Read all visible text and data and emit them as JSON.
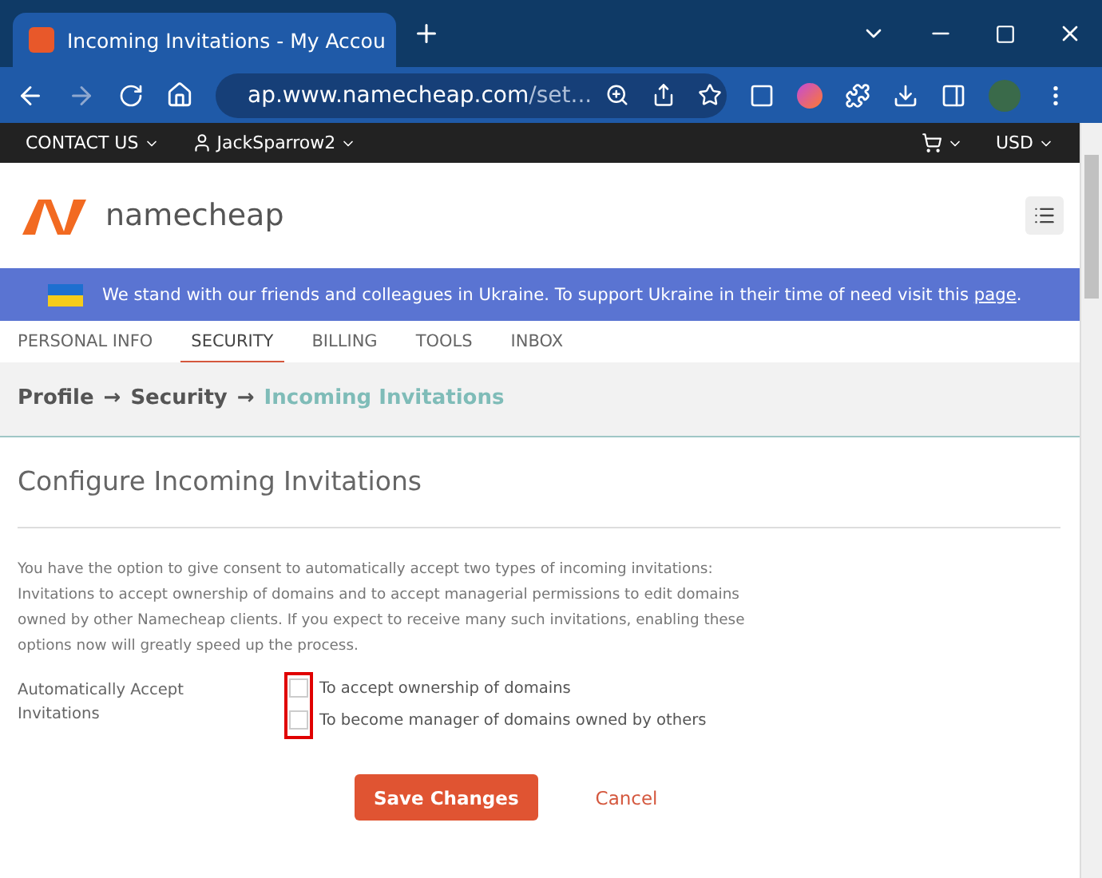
{
  "browser": {
    "tab_title": "Incoming Invitations - My Accou",
    "url_host": "ap.www.namecheap.com",
    "url_rest": "/set..."
  },
  "topbar": {
    "contact": "CONTACT US",
    "user": "JackSparrow2",
    "currency": "USD"
  },
  "logo": {
    "text": "namecheap"
  },
  "banner": {
    "text": "We stand with our friends and colleagues in Ukraine. To support Ukraine in their time of need visit this ",
    "link": "page",
    "end": "."
  },
  "tabs": [
    {
      "label": "PERSONAL INFO",
      "selected": false
    },
    {
      "label": "SECURITY",
      "selected": true
    },
    {
      "label": "BILLING",
      "selected": false
    },
    {
      "label": "TOOLS",
      "selected": false
    },
    {
      "label": "INBOX",
      "selected": false
    }
  ],
  "breadcrumb": [
    {
      "label": "Profile",
      "current": false
    },
    {
      "label": "Security",
      "current": false
    },
    {
      "label": "Incoming Invitations",
      "current": true
    }
  ],
  "breadcrumb_separator": "→",
  "heading": "Configure Incoming Invitations",
  "description": "You have the option to give consent to automatically accept two types of incoming invitations: Invitations to accept ownership of domains and to accept managerial permissions to edit domains owned by other Namecheap clients. If you expect to receive many such invitations, enabling these options now will greatly speed up the process.",
  "setting_label": "Automatically Accept Invitations",
  "options": [
    {
      "label": "To accept ownership of domains",
      "checked": false
    },
    {
      "label": "To become manager of domains owned by others",
      "checked": false
    }
  ],
  "buttons": {
    "save": "Save Changes",
    "cancel": "Cancel"
  }
}
